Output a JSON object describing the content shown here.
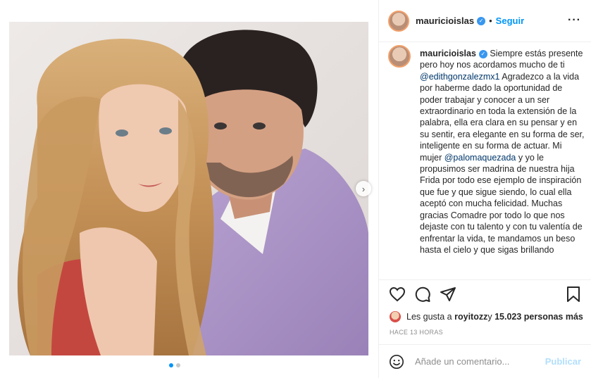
{
  "header": {
    "username": "mauricioislas",
    "separator": "•",
    "follow_label": "Seguir",
    "more_label": "···"
  },
  "caption": {
    "username": "mauricioislas",
    "text_1": " Siempre estás presente pero hoy nos acordamos mucho de ti ",
    "mention_1": "@edithgonzalezmx1",
    "text_2": " Agradezco a la vida por haberme dado la oportunidad de poder trabajar y conocer a un ser extraordinario en toda la extensión de la palabra, ella era clara en su pensar y en su sentir, era elegante en su forma de ser, inteligente en su forma de actuar. Mi mujer ",
    "mention_2": "@palomaquezada",
    "text_3": " y yo le propusimos ser madrina de nuestra hija Frida por todo ese ejemplo de inspiración que fue y que sigue siendo, lo cual ella aceptó con mucha felicidad. Muchas gracias Comadre por todo lo que nos dejaste con tu talento y con tu valentía de enfrentar la vida, te mandamos un beso hasta el cielo y que sigas brillando"
  },
  "likes": {
    "prefix": "Les gusta a ",
    "user": "royitozz",
    "middle": " y ",
    "count": "15.023 personas más"
  },
  "timestamp": "HACE 13 HORAS",
  "comment_box": {
    "placeholder": "Añade un comentario...",
    "publish_label": "Publicar"
  },
  "icons": {
    "like": "heart-icon",
    "comment": "comment-icon",
    "share": "share-icon",
    "save": "bookmark-icon",
    "emoji": "emoji-icon",
    "next": "chevron-right-icon",
    "verified": "verified-badge-icon"
  },
  "colors": {
    "accent": "#0095f6",
    "verified": "#3897f0",
    "publish_disabled": "#b2dffc",
    "muted": "#8e8e8e"
  },
  "carousel": {
    "slides": 2,
    "active": 1
  }
}
